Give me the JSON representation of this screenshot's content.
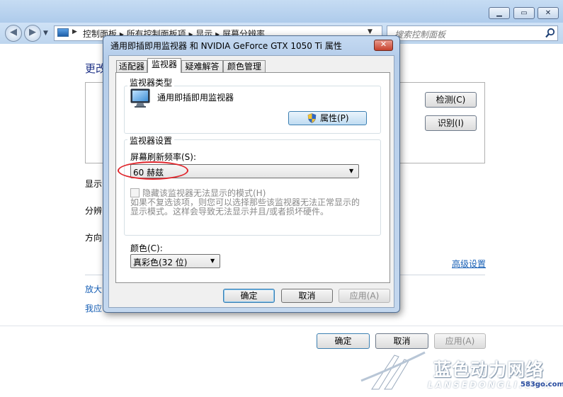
{
  "background_window": {
    "address": {
      "crumbs": "控制面板  ▸  所有控制面板项  ▸  显示  ▸  屏幕分辨率"
    },
    "search": {
      "placeholder": "搜索控制面板"
    },
    "heading": "更改",
    "buttons": {
      "detect": "检测(C)",
      "identify": "识别(I)",
      "ok": "确定",
      "cancel": "取消",
      "apply": "应用(A)"
    },
    "labels": {
      "display": "显示",
      "resolution": "分辨",
      "orientation": "方向"
    },
    "advanced_link": "高级设置",
    "links": {
      "enlarge": "放大",
      "which": "我应"
    }
  },
  "dialog": {
    "title": "通用即插即用监视器 和 NVIDIA GeForce GTX 1050 Ti 属性",
    "tabs": [
      "适配器",
      "监视器",
      "疑难解答",
      "颜色管理"
    ],
    "active_tab": "监视器",
    "monitor_type": {
      "group_label": "监视器类型",
      "name": "通用即插即用监视器",
      "properties_button": "属性(P)"
    },
    "monitor_settings": {
      "group_label": "监视器设置",
      "refresh_label": "屏幕刷新频率(S):",
      "refresh_value": "60 赫兹",
      "hide_modes_label": "隐藏该监视器无法显示的模式(H)",
      "hide_modes_checked": false,
      "hide_modes_desc": "如果不复选该项，则您可以选择那些该监视器无法正常显示的显示模式。这样会导致无法显示并且/或者损坏硬件。"
    },
    "color": {
      "label": "颜色(C):",
      "value": "真彩色(32 位)"
    },
    "buttons": {
      "ok": "确定",
      "cancel": "取消",
      "apply": "应用(A)"
    }
  },
  "watermark": {
    "cn": "蓝色动力网络",
    "en": "LANSEDONGLI.COM",
    "site": "583go.com"
  },
  "colors": {
    "titlebar": "#aecbeb",
    "link": "#1860b6",
    "highlight": "#e0262c"
  }
}
